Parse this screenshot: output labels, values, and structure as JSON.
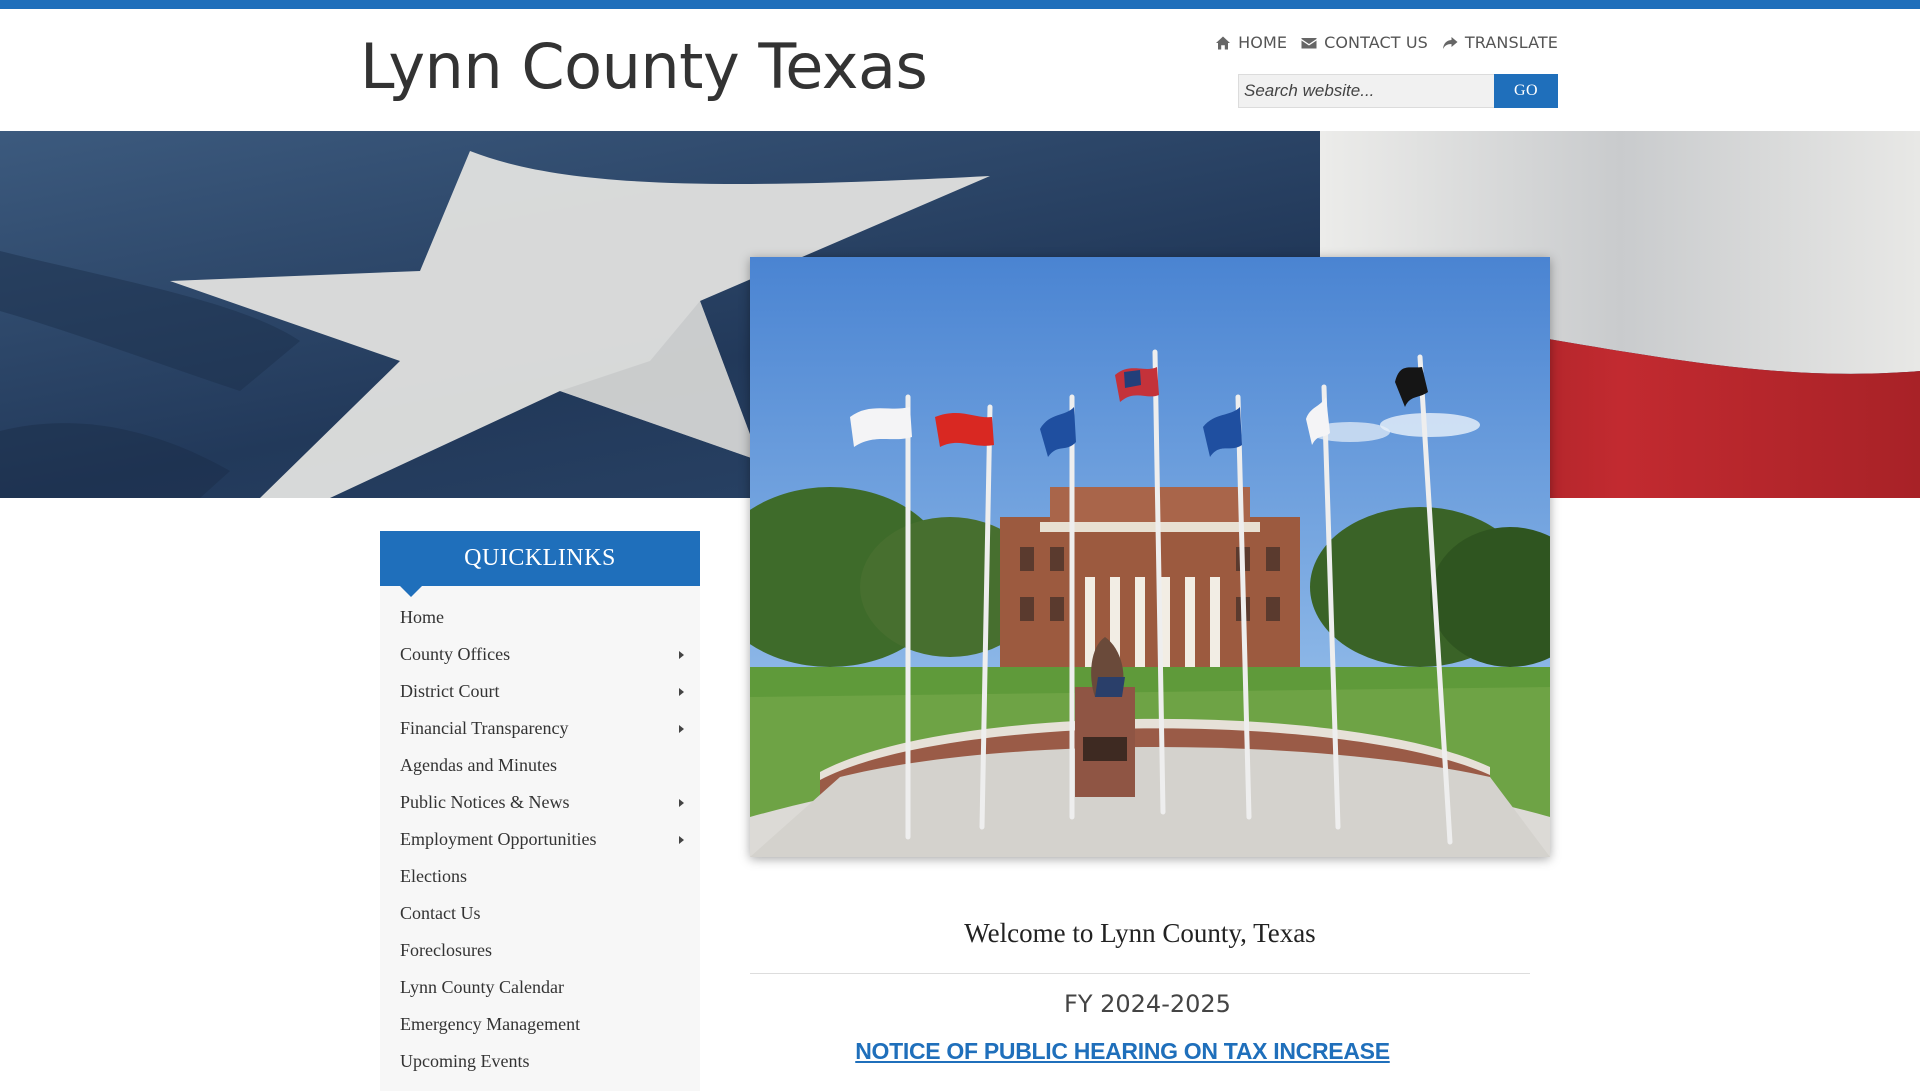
{
  "site": {
    "title": "Lynn County Texas"
  },
  "topnav": [
    {
      "label": "HOME",
      "icon": "home-icon"
    },
    {
      "label": "CONTACT US",
      "icon": "envelope-icon"
    },
    {
      "label": "TRANSLATE",
      "icon": "share-icon"
    }
  ],
  "search": {
    "placeholder": "Search website...",
    "button_label": "GO"
  },
  "quicklinks": {
    "title": "QUICKLINKS",
    "items": [
      {
        "label": "Home",
        "has_submenu": false
      },
      {
        "label": "County Offices",
        "has_submenu": true
      },
      {
        "label": "District Court",
        "has_submenu": true
      },
      {
        "label": "Financial Transparency",
        "has_submenu": true
      },
      {
        "label": "Agendas and Minutes",
        "has_submenu": false
      },
      {
        "label": "Public Notices & News",
        "has_submenu": true
      },
      {
        "label": "Employment Opportunities",
        "has_submenu": true
      },
      {
        "label": "Elections",
        "has_submenu": false
      },
      {
        "label": "Contact Us",
        "has_submenu": false
      },
      {
        "label": "Foreclosures",
        "has_submenu": false
      },
      {
        "label": "Lynn County Calendar",
        "has_submenu": false
      },
      {
        "label": "Emergency Management",
        "has_submenu": false
      },
      {
        "label": "Upcoming Events",
        "has_submenu": false
      }
    ]
  },
  "main": {
    "welcome": "Welcome to Lynn County, Texas",
    "fiscal_year": "FY 2024-2025",
    "notice_link": " NOTICE OF PUBLIC HEARING ON TAX INCREASE"
  },
  "colors": {
    "brand_blue": "#1f6fbb",
    "flag_red": "#b3262b",
    "flag_navy": "#2b4566"
  }
}
